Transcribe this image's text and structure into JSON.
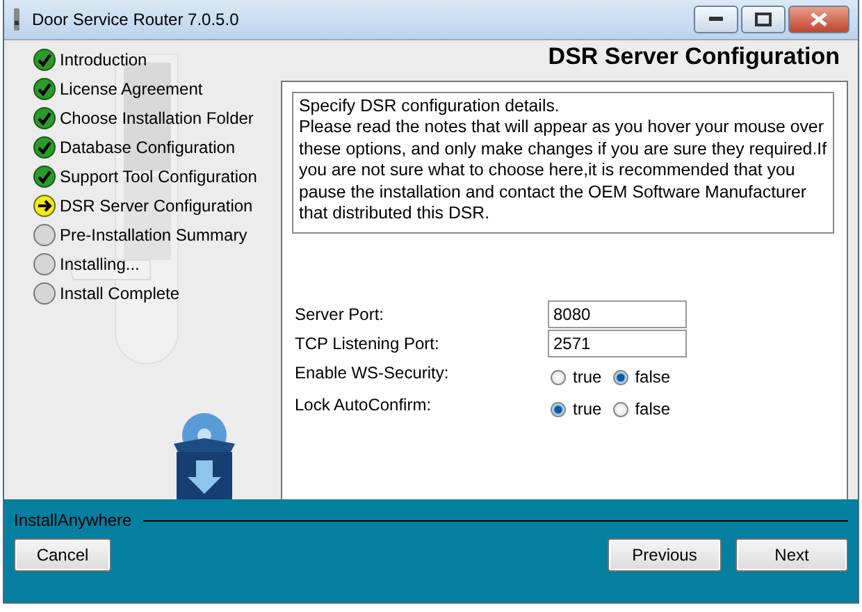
{
  "window": {
    "title": "Door Service Router 7.0.5.0"
  },
  "steps": [
    {
      "label": "Introduction",
      "kind": "done"
    },
    {
      "label": "License Agreement",
      "kind": "done"
    },
    {
      "label": "Choose Installation Folder",
      "kind": "done"
    },
    {
      "label": "Database Configuration",
      "kind": "done"
    },
    {
      "label": "Support Tool Configuration",
      "kind": "done"
    },
    {
      "label": "DSR Server Configuration",
      "kind": "current"
    },
    {
      "label": "Pre-Installation Summary",
      "kind": "pending"
    },
    {
      "label": "Installing...",
      "kind": "pending"
    },
    {
      "label": "Install Complete",
      "kind": "pending"
    }
  ],
  "heading": "DSR Server Configuration",
  "description": [
    "Specify DSR configuration details.",
    "Please read the notes that will appear as you hover your mouse over these options, and only make changes if you are sure they required.If you are not sure what to choose here,it is recommended that you pause the installation and contact the OEM Software Manufacturer that distributed this DSR."
  ],
  "fields": [
    {
      "kind": "text",
      "label": "Server Port:",
      "value": "8080"
    },
    {
      "kind": "text",
      "label": "TCP Listening Port:",
      "value": "2571"
    },
    {
      "kind": "radio",
      "label": "Enable WS-Security:",
      "options": [
        {
          "label": "true",
          "selected": false
        },
        {
          "label": "false",
          "selected": true
        }
      ]
    },
    {
      "kind": "radio",
      "label": "Lock AutoConfirm:",
      "options": [
        {
          "label": "true",
          "selected": true
        },
        {
          "label": "false",
          "selected": false
        }
      ]
    }
  ],
  "footer": {
    "brand": "InstallAnywhere",
    "buttons": [
      "Cancel",
      "Previous",
      "Next"
    ]
  }
}
